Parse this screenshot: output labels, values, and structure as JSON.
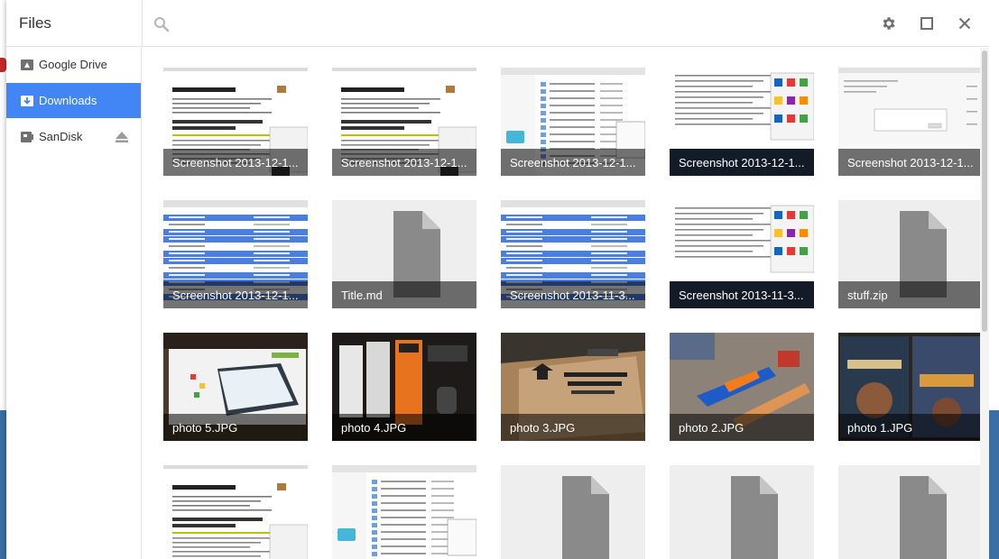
{
  "app": {
    "title": "Files"
  },
  "search": {
    "placeholder": "",
    "value": ""
  },
  "toolbar": {
    "settings_icon": "gear-icon",
    "maximize_icon": "maximize-icon",
    "close_icon": "close-icon"
  },
  "sidebar": {
    "items": [
      {
        "label": "Google Drive",
        "icon": "drive-icon",
        "active": false
      },
      {
        "label": "Downloads",
        "icon": "download-icon",
        "active": true
      },
      {
        "label": "SanDisk",
        "icon": "usb-drive-icon",
        "active": false
      }
    ]
  },
  "files": [
    {
      "name": "Screenshot 2013-12-1...",
      "kind": "doc-screenshot"
    },
    {
      "name": "Screenshot 2013-12-1...",
      "kind": "doc-screenshot"
    },
    {
      "name": "Screenshot 2013-12-1...",
      "kind": "filelist-screenshot"
    },
    {
      "name": "Screenshot 2013-12-1...",
      "kind": "apps-screenshot"
    },
    {
      "name": "Screenshot 2013-12-1...",
      "kind": "dialog-screenshot"
    },
    {
      "name": "Screenshot 2013-12-1...",
      "kind": "blue-list-screenshot"
    },
    {
      "name": "Title.md",
      "kind": "generic-file"
    },
    {
      "name": "Screenshot 2013-11-3...",
      "kind": "blue-list-screenshot"
    },
    {
      "name": "Screenshot 2013-11-3...",
      "kind": "apps-screenshot"
    },
    {
      "name": "stuff.zip",
      "kind": "generic-file"
    },
    {
      "name": "photo 5.JPG",
      "kind": "photo-chromebook-box"
    },
    {
      "name": "photo 4.JPG",
      "kind": "photo-knives"
    },
    {
      "name": "photo 3.JPG",
      "kind": "photo-cardboard-box"
    },
    {
      "name": "photo 2.JPG",
      "kind": "photo-toy-blasters"
    },
    {
      "name": "photo 1.JPG",
      "kind": "photo-dvds"
    },
    {
      "name": "",
      "kind": "doc-screenshot"
    },
    {
      "name": "",
      "kind": "filelist-screenshot"
    },
    {
      "name": "",
      "kind": "generic-file"
    },
    {
      "name": "",
      "kind": "generic-file"
    },
    {
      "name": "",
      "kind": "generic-file"
    }
  ],
  "colors": {
    "accent": "#4285f4",
    "caption_bg": "rgba(0,0,0,0.55)",
    "generic_file": "#8a8a8a"
  }
}
